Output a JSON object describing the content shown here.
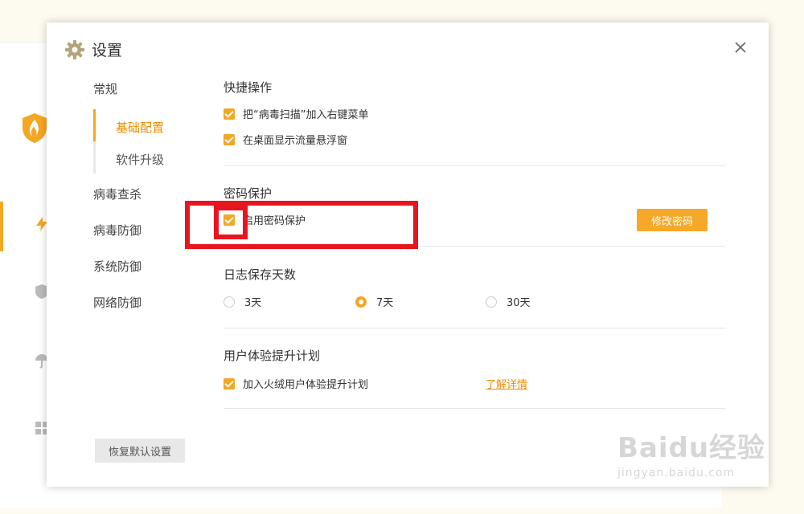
{
  "dialog": {
    "title": "设置",
    "nav": {
      "general": "常规",
      "sub_basic": "基础配置",
      "sub_upgrade": "软件升级",
      "virus_scan": "病毒查杀",
      "virus_defense": "病毒防御",
      "system_defense": "系统防御",
      "network_defense": "网络防御"
    },
    "shortcuts": {
      "title": "快捷操作",
      "opt_context_menu": "把“病毒扫描”加入右键菜单",
      "opt_traffic_window": "在桌面显示流量悬浮窗"
    },
    "password": {
      "title": "密码保护",
      "opt_enable": "启用密码保护",
      "change_button": "修改密码"
    },
    "logs": {
      "title": "日志保存天数",
      "options": [
        "3天",
        "7天",
        "30天"
      ],
      "selected": "7天"
    },
    "ux": {
      "title": "用户体验提升计划",
      "opt_join": "加入火绒用户体验提升计划",
      "details_link": "了解详情"
    },
    "reset_button": "恢复默认设置"
  },
  "watermark": {
    "brand": "Baidu经验",
    "url": "jingyan.baidu.com"
  },
  "colors": {
    "accent": "#f5a623",
    "annotation_red": "#e8141e"
  },
  "icons": [
    "gear-icon",
    "close-icon",
    "huorong-logo-icon",
    "bolt-icon",
    "shield-icon",
    "umbrella-icon",
    "grid-icon"
  ]
}
